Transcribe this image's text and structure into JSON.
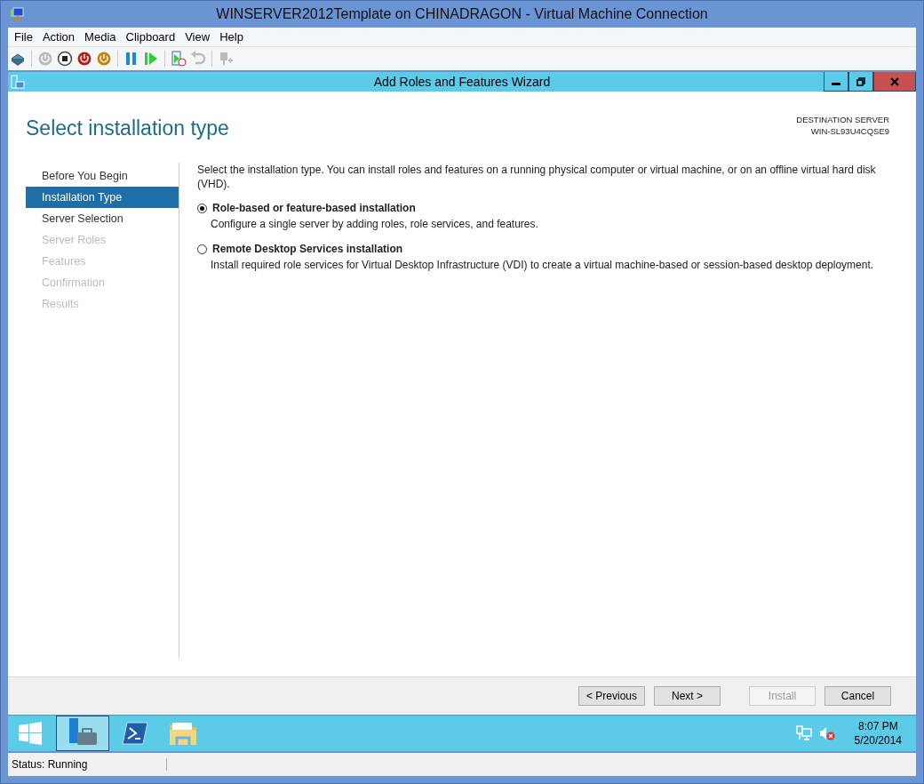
{
  "window": {
    "title": "WINSERVER2012Template on CHINADRAGON - Virtual Machine Connection"
  },
  "menu": [
    "File",
    "Action",
    "Media",
    "Clipboard",
    "View",
    "Help"
  ],
  "wizard": {
    "title": "Add Roles and Features Wizard",
    "heading": "Select installation type",
    "destination_label": "DESTINATION SERVER",
    "destination_server": "WIN-SL93U4CQSE9",
    "steps": [
      {
        "label": "Before You Begin",
        "selected": false,
        "disabled": false
      },
      {
        "label": "Installation Type",
        "selected": true,
        "disabled": false
      },
      {
        "label": "Server Selection",
        "selected": false,
        "disabled": false
      },
      {
        "label": "Server Roles",
        "selected": false,
        "disabled": true
      },
      {
        "label": "Features",
        "selected": false,
        "disabled": true
      },
      {
        "label": "Confirmation",
        "selected": false,
        "disabled": true
      },
      {
        "label": "Results",
        "selected": false,
        "disabled": true
      }
    ],
    "intro": "Select the installation type. You can install roles and features on a running physical computer or virtual machine, or on an offline virtual hard disk (VHD).",
    "options": [
      {
        "label": "Role-based or feature-based installation",
        "description": "Configure a single server by adding roles, role services, and features.",
        "selected": true
      },
      {
        "label": "Remote Desktop Services installation",
        "description": "Install required role services for Virtual Desktop Infrastructure (VDI) to create a virtual machine-based or session-based desktop deployment.",
        "selected": false
      }
    ],
    "buttons": [
      {
        "label": "< Previous",
        "disabled": false
      },
      {
        "label": "Next >",
        "disabled": false
      },
      {
        "label": "Install",
        "disabled": true
      },
      {
        "label": "Cancel",
        "disabled": false
      }
    ]
  },
  "taskbar": {
    "time": "8:07 PM",
    "date": "5/20/2014"
  },
  "status_bar": {
    "text": "Status: Running"
  }
}
